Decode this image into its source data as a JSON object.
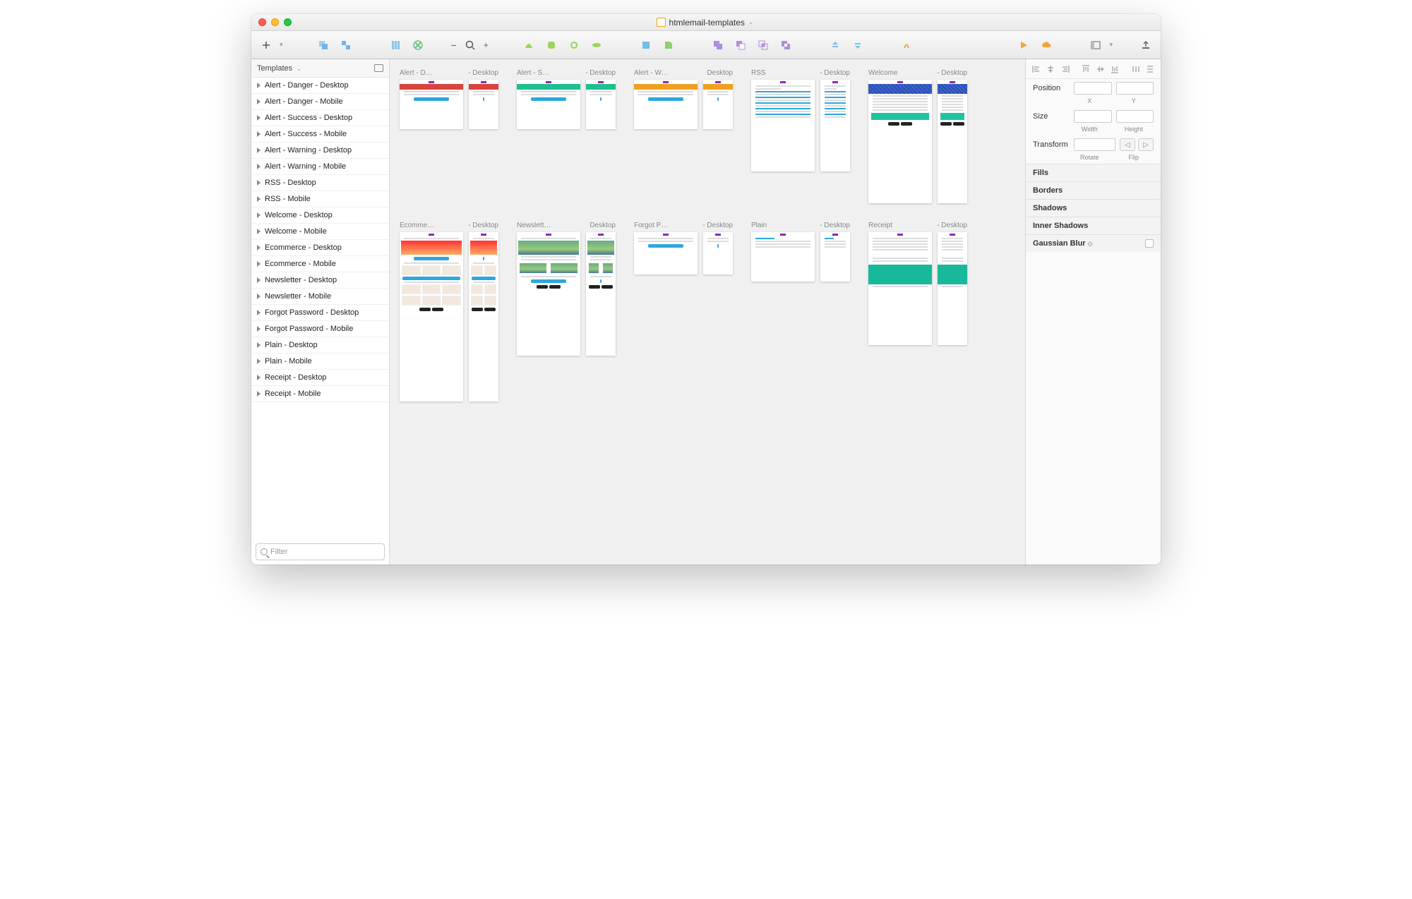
{
  "titlebar": {
    "title": "htmlemail-templates"
  },
  "sidebar": {
    "header": "Templates",
    "filter_placeholder": "Filter",
    "items": [
      "Alert - Danger - Desktop",
      "Alert - Danger - Mobile",
      "Alert - Success - Desktop",
      "Alert - Success - Mobile",
      "Alert - Warning - Desktop",
      "Alert - Warning - Mobile",
      "RSS - Desktop",
      "RSS - Mobile",
      "Welcome - Desktop",
      "Welcome - Mobile",
      "Ecommerce - Desktop",
      "Ecommerce - Mobile",
      "Newsletter - Desktop",
      "Newsletter - Mobile",
      "Forgot Password - Desktop",
      "Forgot Password - Mobile",
      "Plain - Desktop",
      "Plain - Mobile",
      "Receipt - Desktop",
      "Receipt - Mobile"
    ]
  },
  "canvas": {
    "rows": [
      [
        {
          "left": "Alert - D…",
          "right": "- Desktop",
          "type": "alert",
          "accent": "#d9433c"
        },
        {
          "left": "Alert - S…",
          "right": "- Desktop",
          "type": "alert",
          "accent": "#1fbf8f"
        },
        {
          "left": "Alert - W…",
          "right": "Desktop",
          "type": "alert",
          "accent": "#f0a020"
        },
        {
          "left": "RSS",
          "right": "- Desktop",
          "type": "rss"
        },
        {
          "left": "Welcome",
          "right": "- Desktop",
          "type": "welcome"
        }
      ],
      [
        {
          "left": "Ecomme…",
          "right": "- Desktop",
          "type": "ecom"
        },
        {
          "left": "Newslett…",
          "right": "Desktop",
          "type": "news"
        },
        {
          "left": "Forgot P…",
          "right": "- Desktop",
          "type": "forgot"
        },
        {
          "left": "Plain",
          "right": "- Desktop",
          "type": "plain"
        },
        {
          "left": "Receipt",
          "right": "- Desktop",
          "type": "receipt"
        }
      ]
    ]
  },
  "inspector": {
    "position_label": "Position",
    "x_label": "X",
    "y_label": "Y",
    "size_label": "Size",
    "w_label": "Width",
    "h_label": "Height",
    "transform_label": "Transform",
    "rotate_label": "Rotate",
    "flip_label": "Flip",
    "sections": [
      "Fills",
      "Borders",
      "Shadows",
      "Inner Shadows",
      "Gaussian Blur"
    ]
  }
}
